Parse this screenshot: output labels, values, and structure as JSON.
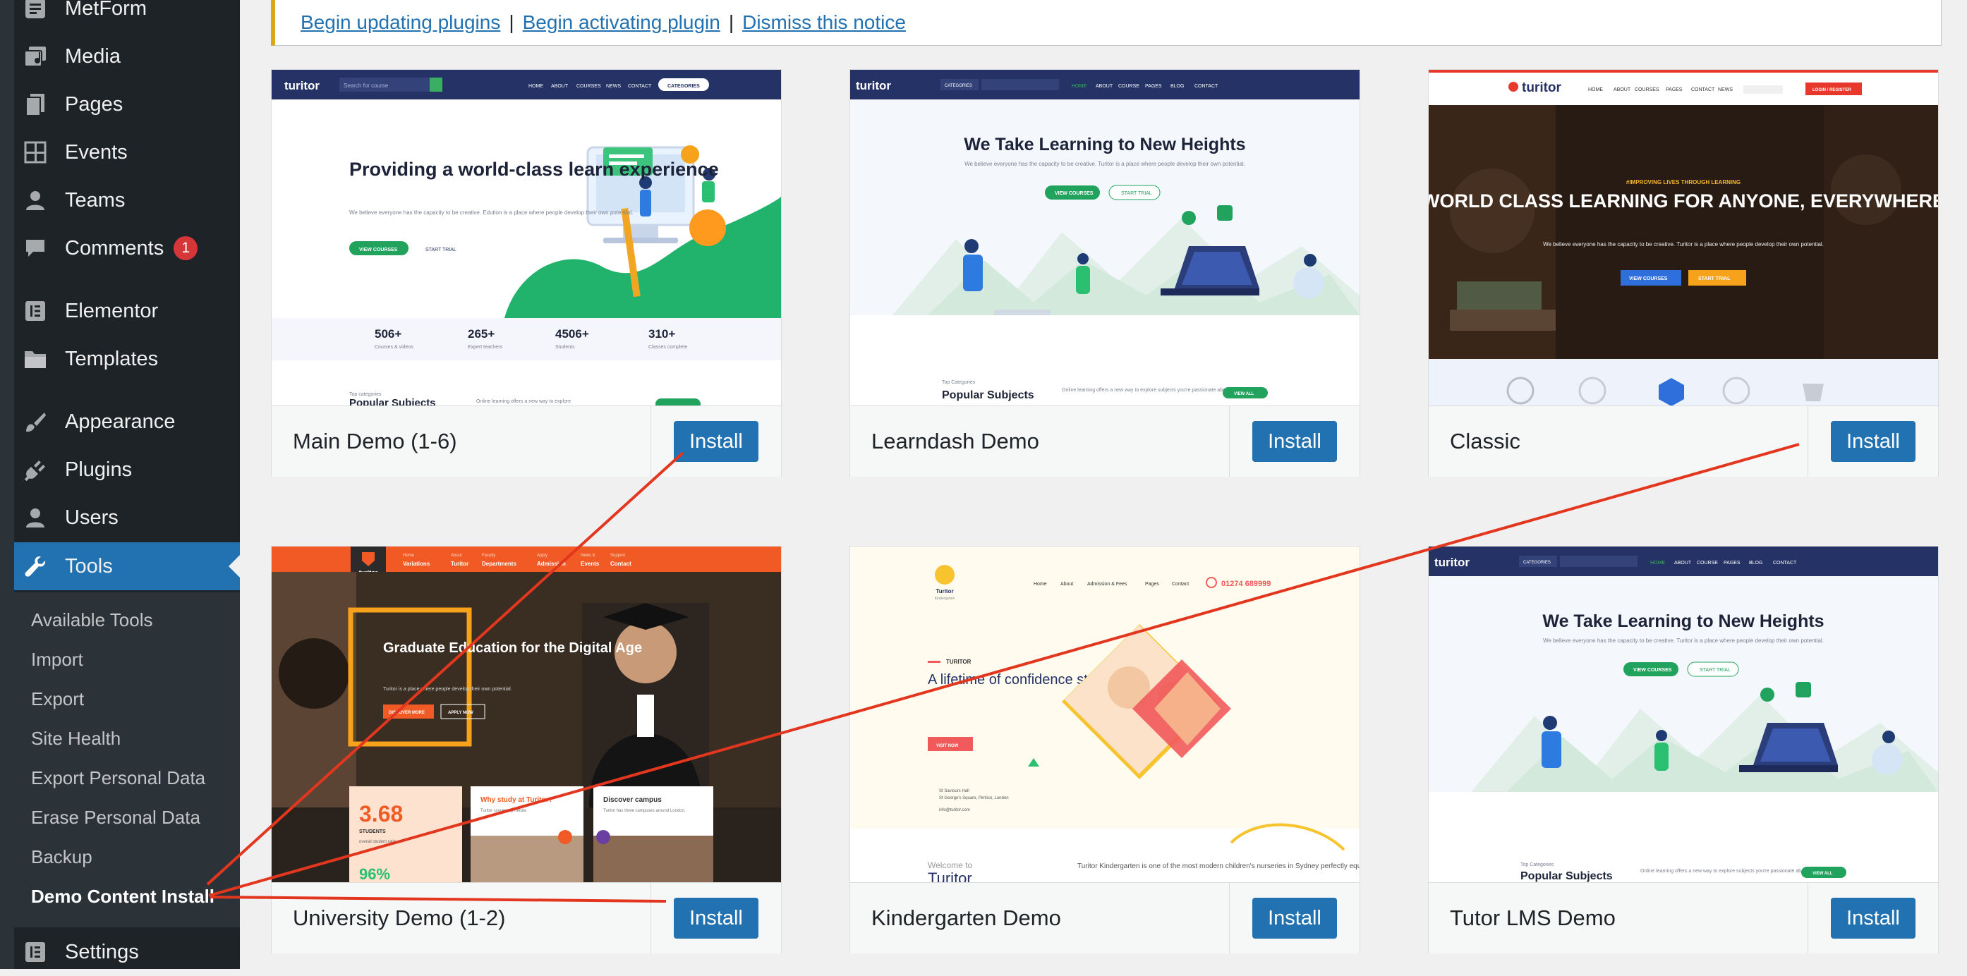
{
  "sidebar": {
    "items": [
      {
        "label": "MetForm",
        "icon": "metform-icon"
      },
      {
        "label": "Media",
        "icon": "media-icon"
      },
      {
        "label": "Pages",
        "icon": "pages-icon"
      },
      {
        "label": "Events",
        "icon": "events-icon"
      },
      {
        "label": "Teams",
        "icon": "teams-icon"
      },
      {
        "label": "Comments",
        "icon": "comments-icon",
        "badge": "1"
      },
      {
        "label": "Elementor",
        "icon": "elementor-icon"
      },
      {
        "label": "Templates",
        "icon": "templates-icon"
      },
      {
        "label": "Appearance",
        "icon": "appearance-icon"
      },
      {
        "label": "Plugins",
        "icon": "plugins-icon"
      },
      {
        "label": "Users",
        "icon": "users-icon"
      },
      {
        "label": "Tools",
        "icon": "tools-icon",
        "active": true
      },
      {
        "label": "Settings",
        "icon": "settings-icon"
      }
    ],
    "submenu": [
      "Available Tools",
      "Import",
      "Export",
      "Site Health",
      "Export Personal Data",
      "Erase Personal Data",
      "Backup",
      "Demo Content Install"
    ]
  },
  "notice": {
    "link1": "Begin updating plugins",
    "sep1": "|",
    "link2": "Begin activating plugin",
    "sep2": "|",
    "link3": "Dismiss this notice"
  },
  "demos": [
    {
      "title": "Main Demo (1-6)",
      "button": "Install",
      "preview": {
        "brand": "turitor",
        "search": "Search for course",
        "nav": [
          "HOME",
          "ABOUT",
          "COURSES",
          "NEWS",
          "CONTACT"
        ],
        "categories": "CATEGORIES",
        "heading": "Providing a world-class learn experience",
        "text": "We believe everyone has the capacity to be creative. Edution is a place where people develop their own potential.",
        "btn1": "VIEW COURSES",
        "btn2": "START TRIAL",
        "stats": [
          {
            "num": "506+",
            "label": "Courses & videos"
          },
          {
            "num": "265+",
            "label": "Expert teachers"
          },
          {
            "num": "4506+",
            "label": "Students"
          },
          {
            "num": "310+",
            "label": "Classes complete"
          }
        ],
        "subhead": "Top categories",
        "subtitle": "Popular Subjects",
        "note": "Online learning offers a new way to explore"
      }
    },
    {
      "title": "Learndash Demo",
      "button": "Install",
      "preview": {
        "brand": "turitor",
        "categories": "CATEGORIES",
        "nav": [
          "HOME",
          "ABOUT",
          "COURSE",
          "PAGES",
          "BLOG",
          "CONTACT"
        ],
        "heading": "We Take Learning to New Heights",
        "text": "We believe everyone has the capacity to be creative. Turitor is a place where people develop their own potential.",
        "btn1": "VIEW COURSES",
        "btn2": "START TRIAL",
        "subhead": "Top Categories",
        "subtitle": "Popular Subjects",
        "note": "Online learning offers a new way to explore subjects you're passionate about.",
        "viewall": "VIEW ALL"
      }
    },
    {
      "title": "Classic",
      "button": "Install",
      "preview": {
        "brand": "turitor",
        "nav": [
          "HOME",
          "ABOUT",
          "COURSES",
          "PAGES",
          "CONTACT",
          "NEWS"
        ],
        "login": "LOGIN / REGISTER",
        "kicker": "#IMPROVING LIVES THROUGH LEARNING",
        "heading": "WORLD CLASS LEARNING FOR ANYONE, EVERYWHERE",
        "text": "We believe everyone has the capacity to be creative. Turitor is a place where people develop their own potential.",
        "btn1": "VIEW COURSES",
        "btn2": "START TRIAL"
      }
    },
    {
      "title": "University Demo (1-2)",
      "button": "Install",
      "preview": {
        "brand": "turitor",
        "tagline": "UNIVERSITY",
        "nav": [
          {
            "t": "Home",
            "s": "Variations"
          },
          {
            "t": "About",
            "s": "Turitor"
          },
          {
            "t": "Faculty",
            "s": "Departments"
          },
          {
            "t": "Apply",
            "s": "Admission"
          },
          {
            "t": "News &",
            "s": "Events"
          },
          {
            "t": "Support",
            "s": "Contact"
          }
        ],
        "heading": "Graduate Education for the Digital Age",
        "text": "Turitor is a place where people develop their own potential.",
        "btn1": "DISCOVER MORE",
        "btn2": "APPLY NOW",
        "stat": "3.68",
        "statlabel": "STUDENTS",
        "stattext": "overall student ratio",
        "card1": "Why study at Turitor?",
        "card1text": "Turitor scores top media",
        "card2": "Discover campus",
        "card2text": "Turitor has three campuses around London.",
        "stat2": "96%"
      }
    },
    {
      "title": "Kindergarten Demo",
      "button": "Install",
      "preview": {
        "brand": "Turitor",
        "sub": "Kindergarten",
        "nav": [
          "Home",
          "About",
          "Admission & Fees",
          "Pages",
          "Contact"
        ],
        "phone": "01274 689999",
        "kicker": "TURITOR",
        "heading": "A lifetime of confidence starts here.",
        "btn1": "VISIT NOW",
        "address1": "St Saviours Hall",
        "address2": "St George's Square, Pimlico, London",
        "email": "info@turitor.com",
        "welcome": "Welcome to",
        "welcome2": "Turitor",
        "desc": "Turitor Kindergarten is one of the most modern children's nurseries in Sydney perfectly equipped to"
      }
    },
    {
      "title": "Tutor LMS Demo",
      "button": "Install",
      "preview": {
        "brand": "turitor",
        "categories": "CATEGORIES",
        "nav": [
          "HOME",
          "ABOUT",
          "COURSE",
          "PAGES",
          "BLOG",
          "CONTACT"
        ],
        "heading": "We Take Learning to New Heights",
        "text": "We believe everyone has the capacity to be creative. Turitor is a place where people develop their own potential.",
        "btn1": "VIEW COURSES",
        "btn2": "START TRIAL",
        "subhead": "Top Categories",
        "subtitle": "Popular Subjects",
        "note": "Online learning offers a new way to explore subjects you're passionate about.",
        "viewall": "VIEW ALL"
      }
    }
  ],
  "colors": {
    "sidebar": "#1d2327",
    "active": "#2271b1",
    "badge": "#d63638",
    "annotation": "#e3361e",
    "notice_border": "#dba617"
  }
}
